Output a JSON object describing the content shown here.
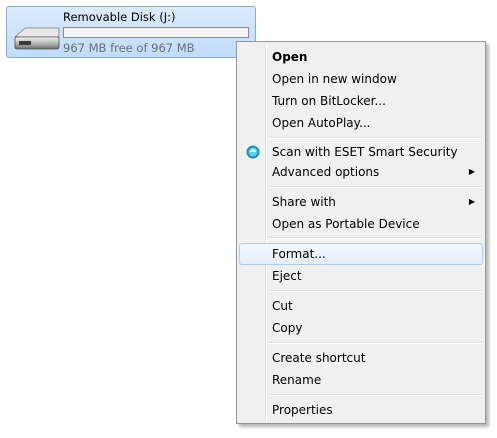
{
  "drive": {
    "name": "Removable Disk (J:)",
    "free_text": "967 MB free of 967 MB",
    "used_fraction": 0
  },
  "menu": {
    "open": "Open",
    "open_new_window": "Open in new window",
    "bitlocker": "Turn on BitLocker...",
    "autoplay": "Open AutoPlay...",
    "eset_scan": "Scan with ESET Smart Security",
    "advanced": "Advanced options",
    "share": "Share with",
    "portable": "Open as Portable Device",
    "format": "Format...",
    "eject": "Eject",
    "cut": "Cut",
    "copy": "Copy",
    "shortcut": "Create shortcut",
    "rename": "Rename",
    "properties": "Properties"
  },
  "icons": {
    "drive": "removable-drive-icon",
    "eset": "eset-icon",
    "submenu": "submenu-arrow-icon"
  },
  "colors": {
    "highlight": "#e4eefb",
    "menu_bg": "#f0f0f0",
    "drive_selection": "#c1dcfc"
  }
}
